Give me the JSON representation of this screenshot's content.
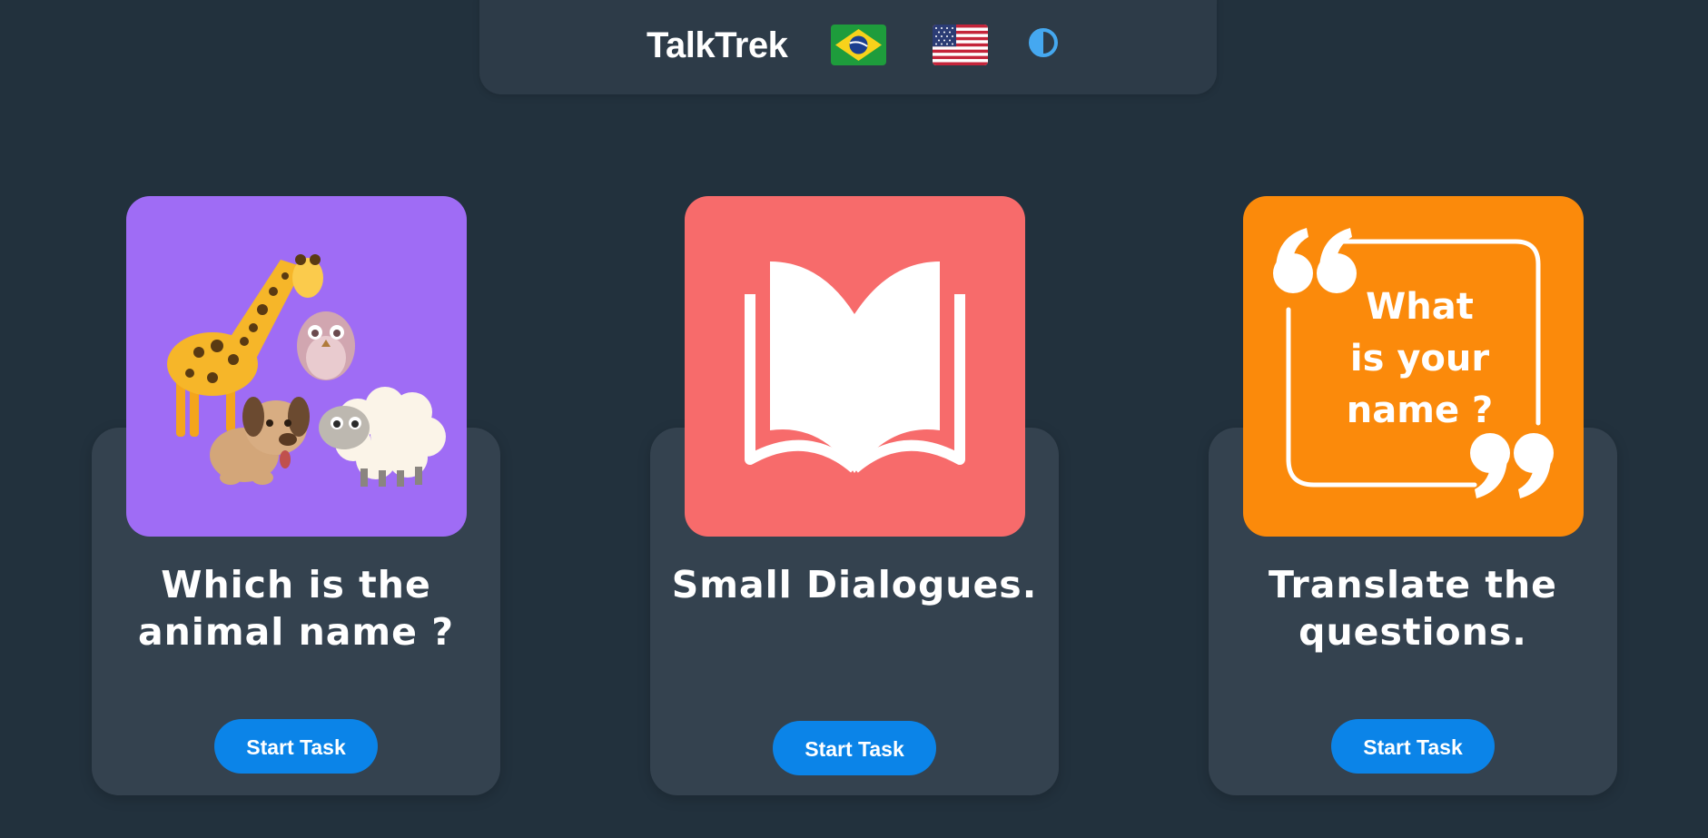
{
  "app": {
    "brand": "TalkTrek"
  },
  "header": {
    "flags": [
      {
        "name": "brazil-flag-icon"
      },
      {
        "name": "usa-flag-icon"
      }
    ],
    "theme_toggle_icon": "contrast-icon",
    "accent": "#45a8f0"
  },
  "cards": [
    {
      "title": "Which is the animal name ?",
      "button_label": "Start Task",
      "tile_color": "#9f6cf5",
      "image_icon": "animals-illustration"
    },
    {
      "title": "Small Dialogues.",
      "button_label": "Start Task",
      "tile_color": "#f76b6b",
      "image_icon": "open-book-icon"
    },
    {
      "title": "Translate the questions.",
      "button_label": "Start Task",
      "tile_color": "#fb8a0b",
      "image_icon": "quote-icon",
      "image_text_lines": [
        "What",
        "is your",
        "name ?"
      ]
    }
  ],
  "colors": {
    "background": "#22313d",
    "card": "#34424f",
    "button": "#0b84e8"
  }
}
